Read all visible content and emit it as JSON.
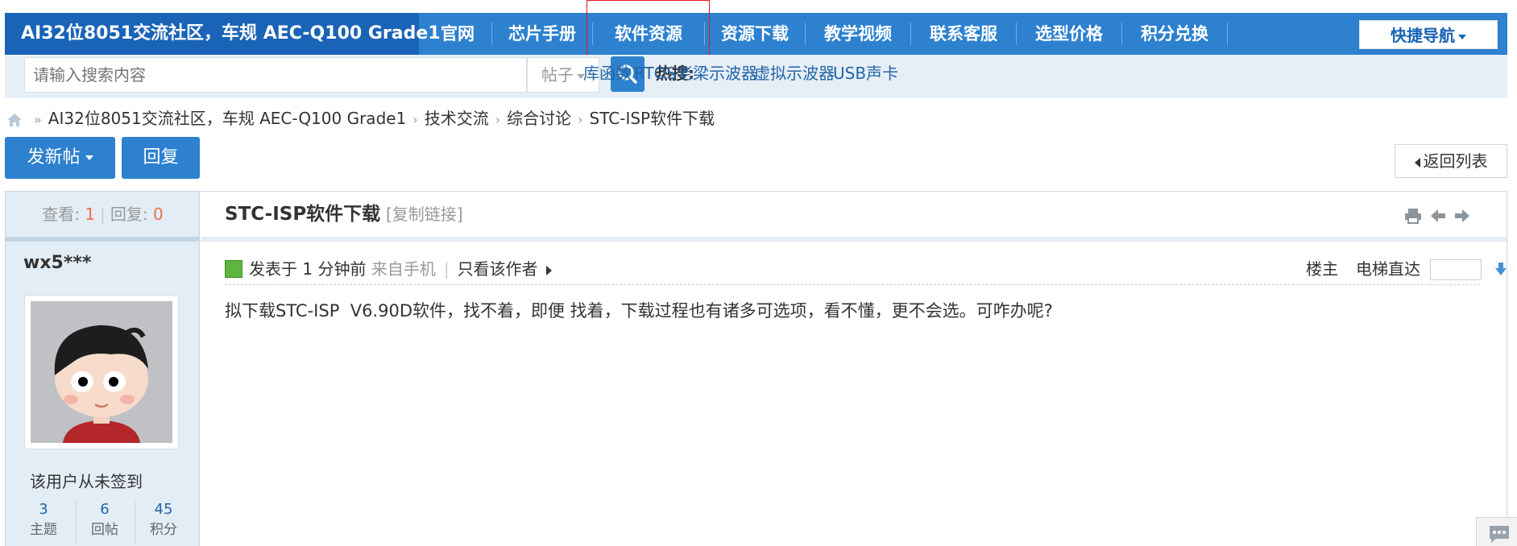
{
  "nav": {
    "brand": "AI32位8051交流社区，车规 AEC-Q100 Grade1",
    "items": [
      {
        "label": "官网"
      },
      {
        "label": "芯片手册"
      },
      {
        "label": "软件资源"
      },
      {
        "label": "资源下载"
      },
      {
        "label": "教学视频"
      },
      {
        "label": "联系客服"
      },
      {
        "label": "选型价格"
      },
      {
        "label": "积分兑换"
      }
    ],
    "quick_nav": "快捷导航",
    "colors": {
      "bar": "#2d81cf",
      "brand_bg": "#1a64b7",
      "highlight": "#e0161b"
    }
  },
  "search": {
    "placeholder": "请输入搜索内容",
    "scope": "帖子",
    "hot_label": "热搜:",
    "hot_links": [
      "库函数",
      "RTOS",
      "老梁示波器",
      "虚拟示波器",
      "USB声卡"
    ]
  },
  "breadcrumb": {
    "items": [
      "AI32位8051交流社区，车规 AEC-Q100 Grade1",
      "技术交流",
      "综合讨论",
      "STC-ISP软件下载"
    ],
    "lead_sep": "»",
    "sep": "›"
  },
  "actions": {
    "new_post": "发新帖",
    "reply": "回复",
    "back_to_list": "返回列表"
  },
  "thread": {
    "views_label": "查看:",
    "views": "1",
    "replies_label": "回复:",
    "replies": "0",
    "title": "STC-ISP软件下载",
    "copy_link": "[复制链接]"
  },
  "author": {
    "name": "wx5***",
    "signin": "该用户从未签到",
    "stats": [
      {
        "value": "3",
        "label": "主题"
      },
      {
        "value": "6",
        "label": "回帖"
      },
      {
        "value": "45",
        "label": "积分"
      }
    ]
  },
  "post": {
    "posted_prefix": "发表于",
    "time": "1 分钟前",
    "source": "来自手机",
    "only_author": "只看该作者",
    "floor": "楼主",
    "elevator": "电梯直达",
    "body": "拟下载STC-ISP  V6.90D软件，找不着，即便 找着，下载过程也有诸多可选项，看不懂，更不会选。可咋办呢?"
  }
}
